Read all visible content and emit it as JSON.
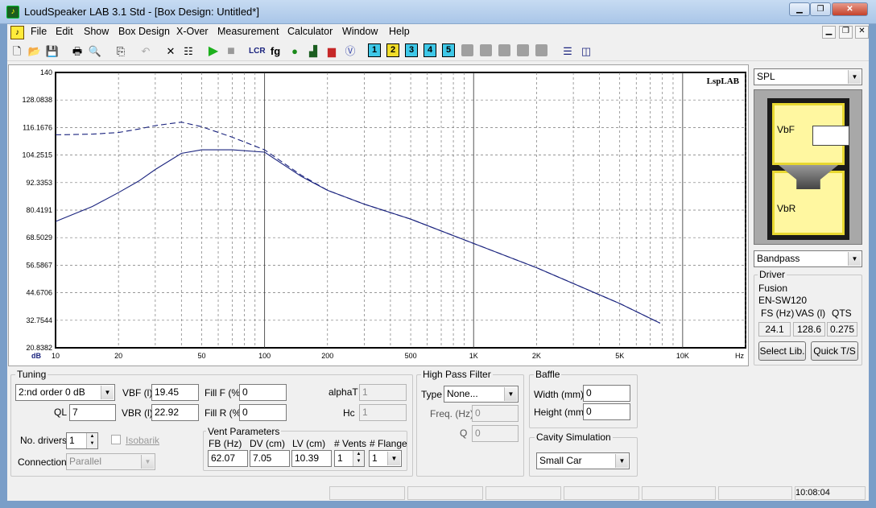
{
  "window": {
    "title": "LoudSpeaker LAB 3.1 Std - [Box Design: Untitled*]",
    "min": "▁",
    "max": "❐",
    "close": "✕"
  },
  "mdi": {
    "min": "▁",
    "restore": "❐",
    "close": "✕"
  },
  "menu": [
    {
      "label": "File"
    },
    {
      "label": "Edit"
    },
    {
      "label": "Show"
    },
    {
      "label": "Box Design"
    },
    {
      "label": "X-Over"
    },
    {
      "label": "Measurement"
    },
    {
      "label": "Calculator"
    },
    {
      "label": "Window"
    },
    {
      "label": "Help"
    }
  ],
  "toolbar": {
    "numbers": [
      "1",
      "2",
      "3",
      "4",
      "5"
    ],
    "colors": {
      "n1": "#3ec8e8",
      "n2": "#f0dc28",
      "n3": "#3ec8e8",
      "n4": "#3ec8e8",
      "n5": "#3ec8e8"
    },
    "lcr": "LCR",
    "fg": "fg",
    "play_color": "#1db01d"
  },
  "chart_data": {
    "type": "line",
    "title": "",
    "watermark": "LspLAB",
    "xlabel": "Hz",
    "ylabel": "dB",
    "xscale": "log",
    "xlim": [
      10,
      20000
    ],
    "ylim": [
      20.8382,
      140
    ],
    "yticks": [
      "140",
      "128.0838",
      "116.1676",
      "104.2515",
      "92.3353",
      "80.4191",
      "68.5029",
      "56.5867",
      "44.6706",
      "32.7544",
      "20.8382"
    ],
    "xticks": [
      "10",
      "20",
      "50",
      "100",
      "200",
      "500",
      "1K",
      "2K",
      "5K",
      "10K"
    ],
    "grid": true,
    "series": [
      {
        "style": "solid",
        "x": [
          10,
          15,
          20,
          25,
          30,
          40,
          50,
          70,
          100,
          150,
          200,
          300,
          500,
          1000,
          2000,
          5000,
          7800
        ],
        "y": [
          75.5,
          82,
          88,
          93,
          98,
          105,
          106.5,
          106.5,
          105.5,
          95,
          89,
          83,
          76.5,
          66,
          55.5,
          40,
          31.5
        ]
      },
      {
        "style": "dashed",
        "x": [
          10,
          15,
          20,
          25,
          30,
          40,
          50,
          70,
          100,
          150,
          200,
          300,
          500,
          1000,
          2000,
          5000,
          7800
        ],
        "y": [
          113,
          113.3,
          114,
          115.5,
          117,
          118.5,
          116.5,
          112,
          106.5,
          95.5,
          89,
          83,
          76.5,
          66,
          55.5,
          40,
          31.5
        ]
      }
    ],
    "line_color": "#1a237e"
  },
  "right": {
    "spl_select": "SPL",
    "box_type_select": "Bandpass",
    "vbf": "VbF",
    "vbr": "VbR",
    "driver": {
      "title": "Driver",
      "brand": "Fusion",
      "model": "EN-SW120",
      "fs_label": "FS (Hz)",
      "vas_label": "VAS (l)",
      "qts_label": "QTS",
      "fs": "24.1",
      "vas": "128.6",
      "qts": "0.275"
    },
    "select_lib": "Select Lib.",
    "quick_ts": "Quick T/S"
  },
  "tuning": {
    "title": "Tuning",
    "order": "2:nd order  0 dB",
    "ql_label": "QL",
    "ql": "7",
    "vbf_label": "VBF (l)",
    "vbf": "19.45",
    "vbr_label": "VBR (l)",
    "vbr": "22.92",
    "fillf_label": "Fill F (%)",
    "fillf": "0",
    "fillr_label": "Fill R (%)",
    "fillr": "0",
    "alphat_label": "alphaT",
    "alphat": "1",
    "hc_label": "Hc",
    "hc": "1",
    "drivers_label": "No. drivers",
    "drivers": "1",
    "isobarik": "Isobarik",
    "connection_label": "Connection",
    "connection": "Parallel",
    "vent": {
      "title": "Vent Parameters",
      "fb_label": "FB (Hz)",
      "fb": "62.07",
      "dv_label": "DV (cm)",
      "dv": "7.05",
      "lv_label": "LV (cm)",
      "lv": "10.39",
      "vents_label": "# Vents",
      "vents": "1",
      "flange_label": "# Flange",
      "flange": "1"
    }
  },
  "hpf": {
    "title": "High Pass Filter",
    "type_label": "Type",
    "type": "None...",
    "freq_label": "Freq. (Hz)",
    "freq": "0",
    "q_label": "Q",
    "q": "0"
  },
  "baffle": {
    "title": "Baffle",
    "width_label": "Width (mm)",
    "width": "0",
    "height_label": "Height (mm)",
    "height": "0"
  },
  "cavity": {
    "title": "Cavity Simulation",
    "value": "Small Car"
  },
  "status": {
    "time": "10:08:04"
  }
}
